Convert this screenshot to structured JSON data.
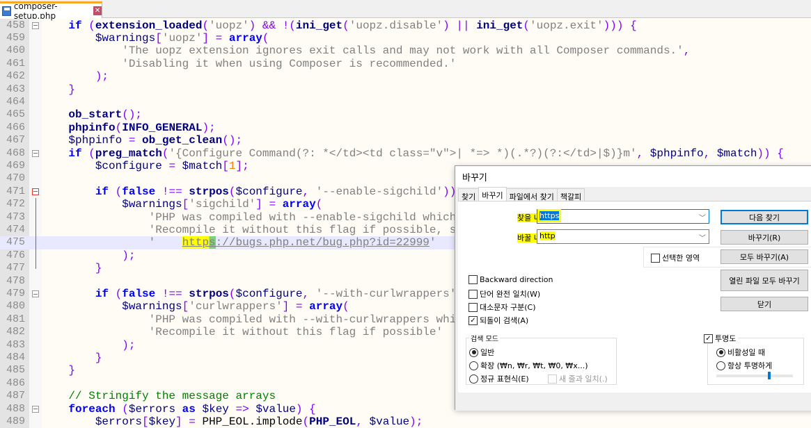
{
  "tab": {
    "filename": "composer-setup.php",
    "close_icon": "close-icon",
    "file_icon": "floppy-save-icon"
  },
  "editor": {
    "current_line": 475,
    "lines": [
      {
        "n": "458",
        "fold": "open",
        "t": [
          [
            "p",
            "    "
          ],
          [
            "k",
            "if"
          ],
          [
            "p",
            " "
          ],
          [
            "o",
            "("
          ],
          [
            "f",
            "extension_loaded"
          ],
          [
            "o",
            "("
          ],
          [
            "s",
            "'uopz'"
          ],
          [
            "o",
            ")"
          ],
          [
            "p",
            " "
          ],
          [
            "o",
            "&&"
          ],
          [
            "p",
            " "
          ],
          [
            "o",
            "!("
          ],
          [
            "f",
            "ini_get"
          ],
          [
            "o",
            "("
          ],
          [
            "s",
            "'uopz.disable'"
          ],
          [
            "o",
            ")"
          ],
          [
            "p",
            " "
          ],
          [
            "o",
            "||"
          ],
          [
            "p",
            " "
          ],
          [
            "f",
            "ini_get"
          ],
          [
            "o",
            "("
          ],
          [
            "s",
            "'uopz.exit'"
          ],
          [
            "o",
            ")))"
          ],
          [
            "p",
            " "
          ],
          [
            "o",
            "{"
          ]
        ]
      },
      {
        "n": "459",
        "t": [
          [
            "p",
            "        "
          ],
          [
            "v",
            "$warnings"
          ],
          [
            "o",
            "["
          ],
          [
            "s",
            "'uopz'"
          ],
          [
            "o",
            "]"
          ],
          [
            "p",
            " "
          ],
          [
            "o",
            "="
          ],
          [
            "p",
            " "
          ],
          [
            "k",
            "array"
          ],
          [
            "o",
            "("
          ]
        ]
      },
      {
        "n": "460",
        "t": [
          [
            "p",
            "            "
          ],
          [
            "s",
            "'The uopz extension ignores exit calls and may not work with all Composer commands.'"
          ],
          [
            "o",
            ","
          ]
        ]
      },
      {
        "n": "461",
        "t": [
          [
            "p",
            "            "
          ],
          [
            "s",
            "'Disabling it when using Composer is recommended.'"
          ]
        ]
      },
      {
        "n": "462",
        "t": [
          [
            "p",
            "        "
          ],
          [
            "o",
            ");"
          ]
        ]
      },
      {
        "n": "463",
        "t": [
          [
            "p",
            "    "
          ],
          [
            "o",
            "}"
          ]
        ]
      },
      {
        "n": "464",
        "t": []
      },
      {
        "n": "465",
        "t": [
          [
            "p",
            "    "
          ],
          [
            "f",
            "ob_start"
          ],
          [
            "o",
            "();"
          ]
        ]
      },
      {
        "n": "466",
        "t": [
          [
            "p",
            "    "
          ],
          [
            "f",
            "phpinfo"
          ],
          [
            "o",
            "("
          ],
          [
            "f",
            "INFO_GENERAL"
          ],
          [
            "o",
            ");"
          ]
        ]
      },
      {
        "n": "467",
        "t": [
          [
            "p",
            "    "
          ],
          [
            "v",
            "$phpinfo"
          ],
          [
            "p",
            " "
          ],
          [
            "o",
            "="
          ],
          [
            "p",
            " "
          ],
          [
            "f",
            "ob_get_clean"
          ],
          [
            "o",
            "();"
          ]
        ]
      },
      {
        "n": "468",
        "fold": "open",
        "t": [
          [
            "p",
            "    "
          ],
          [
            "k",
            "if"
          ],
          [
            "p",
            " "
          ],
          [
            "o",
            "("
          ],
          [
            "f",
            "preg_match"
          ],
          [
            "o",
            "("
          ],
          [
            "s",
            "'{Configure Command(?: *</td><td class=\"v\">| *=> *)(.*?)(?:</td>|$)}m'"
          ],
          [
            "o",
            ","
          ],
          [
            "p",
            " "
          ],
          [
            "v",
            "$phpinfo"
          ],
          [
            "o",
            ","
          ],
          [
            "p",
            " "
          ],
          [
            "v",
            "$match"
          ],
          [
            "o",
            "))"
          ],
          [
            "p",
            " "
          ],
          [
            "o",
            "{"
          ]
        ]
      },
      {
        "n": "469",
        "t": [
          [
            "p",
            "        "
          ],
          [
            "v",
            "$configure"
          ],
          [
            "p",
            " "
          ],
          [
            "o",
            "="
          ],
          [
            "p",
            " "
          ],
          [
            "v",
            "$match"
          ],
          [
            "o",
            "["
          ],
          [
            "n",
            "1"
          ],
          [
            "o",
            "];"
          ]
        ]
      },
      {
        "n": "470",
        "t": []
      },
      {
        "n": "471",
        "fold": "red",
        "t": [
          [
            "p",
            "        "
          ],
          [
            "k",
            "if"
          ],
          [
            "p",
            " "
          ],
          [
            "o",
            "("
          ],
          [
            "k",
            "false"
          ],
          [
            "p",
            " "
          ],
          [
            "o",
            "!=="
          ],
          [
            "p",
            " "
          ],
          [
            "f",
            "strpos"
          ],
          [
            "o",
            "("
          ],
          [
            "v",
            "$configure"
          ],
          [
            "o",
            ","
          ],
          [
            "p",
            " "
          ],
          [
            "s",
            "'--enable-sigchild'"
          ],
          [
            "o",
            "))"
          ],
          [
            "p",
            " "
          ],
          [
            "o",
            "{"
          ]
        ]
      },
      {
        "n": "472",
        "t": [
          [
            "p",
            "            "
          ],
          [
            "v",
            "$warnings"
          ],
          [
            "o",
            "["
          ],
          [
            "s",
            "'sigchild'"
          ],
          [
            "o",
            "]"
          ],
          [
            "p",
            " "
          ],
          [
            "o",
            "="
          ],
          [
            "p",
            " "
          ],
          [
            "k",
            "array"
          ],
          [
            "o",
            "("
          ]
        ]
      },
      {
        "n": "473",
        "t": [
          [
            "p",
            "                "
          ],
          [
            "s",
            "'PHP was compiled with --enable-sigchild which"
          ]
        ]
      },
      {
        "n": "474",
        "t": [
          [
            "p",
            "                "
          ],
          [
            "s",
            "'Recompile it without this flag if possible, s"
          ]
        ]
      },
      {
        "n": "475",
        "t": [
          [
            "p",
            "                "
          ],
          [
            "s",
            "'    "
          ],
          [
            "h",
            "https"
          ],
          [
            "u",
            "://bugs.php.net/bug.php?id=22999"
          ],
          [
            "s",
            "'"
          ]
        ]
      },
      {
        "n": "476",
        "t": [
          [
            "p",
            "            "
          ],
          [
            "o",
            ");"
          ]
        ]
      },
      {
        "n": "477",
        "t": [
          [
            "p",
            "        "
          ],
          [
            "o",
            "}"
          ]
        ]
      },
      {
        "n": "478",
        "t": []
      },
      {
        "n": "479",
        "fold": "open",
        "t": [
          [
            "p",
            "        "
          ],
          [
            "k",
            "if"
          ],
          [
            "p",
            " "
          ],
          [
            "o",
            "("
          ],
          [
            "k",
            "false"
          ],
          [
            "p",
            " "
          ],
          [
            "o",
            "!=="
          ],
          [
            "p",
            " "
          ],
          [
            "f",
            "strpos"
          ],
          [
            "o",
            "("
          ],
          [
            "v",
            "$configure"
          ],
          [
            "o",
            ","
          ],
          [
            "p",
            " "
          ],
          [
            "s",
            "'--with-curlwrappers'"
          ]
        ]
      },
      {
        "n": "480",
        "t": [
          [
            "p",
            "            "
          ],
          [
            "v",
            "$warnings"
          ],
          [
            "o",
            "["
          ],
          [
            "s",
            "'curlwrappers'"
          ],
          [
            "o",
            "]"
          ],
          [
            "p",
            " "
          ],
          [
            "o",
            "="
          ],
          [
            "p",
            " "
          ],
          [
            "k",
            "array"
          ],
          [
            "o",
            "("
          ]
        ]
      },
      {
        "n": "481",
        "t": [
          [
            "p",
            "                "
          ],
          [
            "s",
            "'PHP was compiled with --with-curlwrappers whi"
          ]
        ]
      },
      {
        "n": "482",
        "t": [
          [
            "p",
            "                "
          ],
          [
            "s",
            "'Recompile it without this flag if possible'"
          ]
        ]
      },
      {
        "n": "483",
        "t": [
          [
            "p",
            "            "
          ],
          [
            "o",
            ");"
          ]
        ]
      },
      {
        "n": "484",
        "t": [
          [
            "p",
            "        "
          ],
          [
            "o",
            "}"
          ]
        ]
      },
      {
        "n": "485",
        "t": [
          [
            "p",
            "    "
          ],
          [
            "o",
            "}"
          ]
        ]
      },
      {
        "n": "486",
        "t": []
      },
      {
        "n": "487",
        "t": [
          [
            "p",
            "    "
          ],
          [
            "c",
            "// Stringify the message arrays"
          ]
        ]
      },
      {
        "n": "488",
        "fold": "open",
        "t": [
          [
            "p",
            "    "
          ],
          [
            "k",
            "foreach"
          ],
          [
            "p",
            " "
          ],
          [
            "o",
            "("
          ],
          [
            "v",
            "$errors"
          ],
          [
            "p",
            " "
          ],
          [
            "k",
            "as"
          ],
          [
            "p",
            " "
          ],
          [
            "v",
            "$key"
          ],
          [
            "p",
            " "
          ],
          [
            "o",
            "=>"
          ],
          [
            "p",
            " "
          ],
          [
            "v",
            "$value"
          ],
          [
            "o",
            ")"
          ],
          [
            "p",
            " "
          ],
          [
            "o",
            "{"
          ]
        ]
      },
      {
        "n": "489",
        "t": [
          [
            "p",
            "        "
          ],
          [
            "v",
            "$errors"
          ],
          [
            "o",
            "["
          ],
          [
            "v",
            "$key"
          ],
          [
            "o",
            "]"
          ],
          [
            "p",
            " "
          ],
          [
            "o",
            "="
          ],
          [
            "p",
            " PHP_EOL.implode"
          ],
          [
            "o",
            "("
          ],
          [
            "f",
            "PHP_EOL"
          ],
          [
            "o",
            ","
          ],
          [
            "p",
            " "
          ],
          [
            "v",
            "$value"
          ],
          [
            "o",
            ");"
          ]
        ]
      }
    ]
  },
  "dialog": {
    "title": "바꾸기",
    "tabs": [
      {
        "label": "찾기"
      },
      {
        "label": "바꾸기",
        "active": true
      },
      {
        "label": "파일에서 찾기"
      },
      {
        "label": "책갈피"
      }
    ],
    "find_label": "찾을 내용:",
    "find_value": "https",
    "replace_label": "바꿀 내용:",
    "replace_value": "http",
    "buttons": {
      "find_next": "다음 찾기",
      "replace": "바꾸기(R)",
      "replace_all": "모두 바꾸기(A)",
      "replace_all_open": "열린 파일 모두 바꾸기",
      "close": "닫기"
    },
    "in_selection": {
      "label": "선택한 영역",
      "checked": false
    },
    "options": [
      {
        "label": "Backward direction",
        "checked": false
      },
      {
        "label": "단어 완전 일치(W)",
        "checked": false
      },
      {
        "label": "대소문자 구분(C)",
        "checked": false
      },
      {
        "label": "되돌이 검색(A)",
        "checked": true
      }
    ],
    "search_mode": {
      "title": "검색 모드",
      "normal": "일반",
      "extended": "확장 (₩n, ₩r, ₩t, ₩0, ₩x...)",
      "regex": "정규 표현식(E)",
      "dot_newline": "새 줄과 일치(.)",
      "selected": "normal"
    },
    "transparency": {
      "label": "투명도",
      "checked": true,
      "on_lose_focus": "비활성일 때",
      "always": "항상 투명하게",
      "selected": "on_lose_focus",
      "level_percent": 70
    },
    "highlight_color": "#ffff00"
  }
}
